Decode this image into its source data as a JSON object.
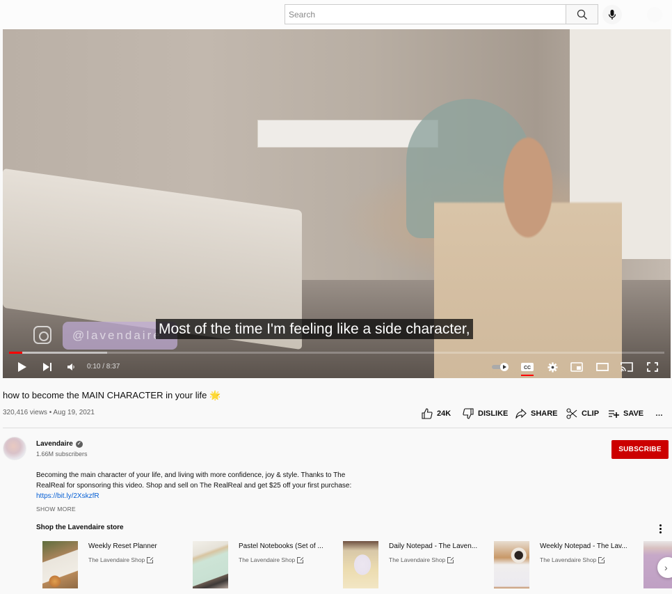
{
  "header": {
    "search_placeholder": "Search",
    "search_value": "",
    "icons": [
      "search-icon",
      "microphone-icon",
      "avatar"
    ]
  },
  "player": {
    "caption": "Most of the time I'm feeling like a side character,",
    "watermark_handle": "@lavendaire",
    "current_time": "0:10",
    "duration": "8:37",
    "time_display": "0:10 / 8:37",
    "progress_played_fraction": 0.02,
    "progress_buffered_fraction": 0.15,
    "controls": [
      "play-icon",
      "next-icon",
      "volume-icon",
      "autoplay-toggle",
      "captions-icon",
      "settings-icon",
      "miniplayer-icon",
      "theater-mode-icon",
      "cast-icon",
      "fullscreen-icon"
    ],
    "captions_on": true,
    "colors": {
      "progress": "#ff0000"
    }
  },
  "video": {
    "title": "how to become the MAIN CHARACTER in your life",
    "title_emoji": "🌟",
    "views": "320,416 views",
    "date": "Aug 19, 2021",
    "meta": "320,416 views • Aug 19, 2021"
  },
  "actions": {
    "like": "24K",
    "dislike": "DISLIKE",
    "share": "SHARE",
    "clip": "CLIP",
    "save": "SAVE",
    "more": "…"
  },
  "channel": {
    "name": "Lavendaire",
    "verified": true,
    "subscribers": "1.66M subscribers",
    "subscribe_label": "SUBSCRIBE",
    "colors": {
      "subscribe": "#cc0000"
    }
  },
  "description": {
    "text": "Becoming the main character of your life, and living with more confidence, joy & style. Thanks to The RealReal for sponsoring this video. Shop and sell on The RealReal and get $25 off your first purchase: ",
    "link": "https://bit.ly/2XskzfR",
    "show_more": "SHOW MORE"
  },
  "shop": {
    "title": "Shop the Lavendaire store",
    "items": [
      {
        "name": "Weekly Reset Planner",
        "vendor": "The Lavendaire Shop"
      },
      {
        "name": "Pastel Notebooks (Set of ...",
        "vendor": "The Lavendaire Shop"
      },
      {
        "name": "Daily Notepad - The Laven...",
        "vendor": "The Lavendaire Shop"
      },
      {
        "name": "Weekly Notepad - The Lav...",
        "vendor": "The Lavendaire Shop"
      }
    ],
    "next_label": "›"
  }
}
